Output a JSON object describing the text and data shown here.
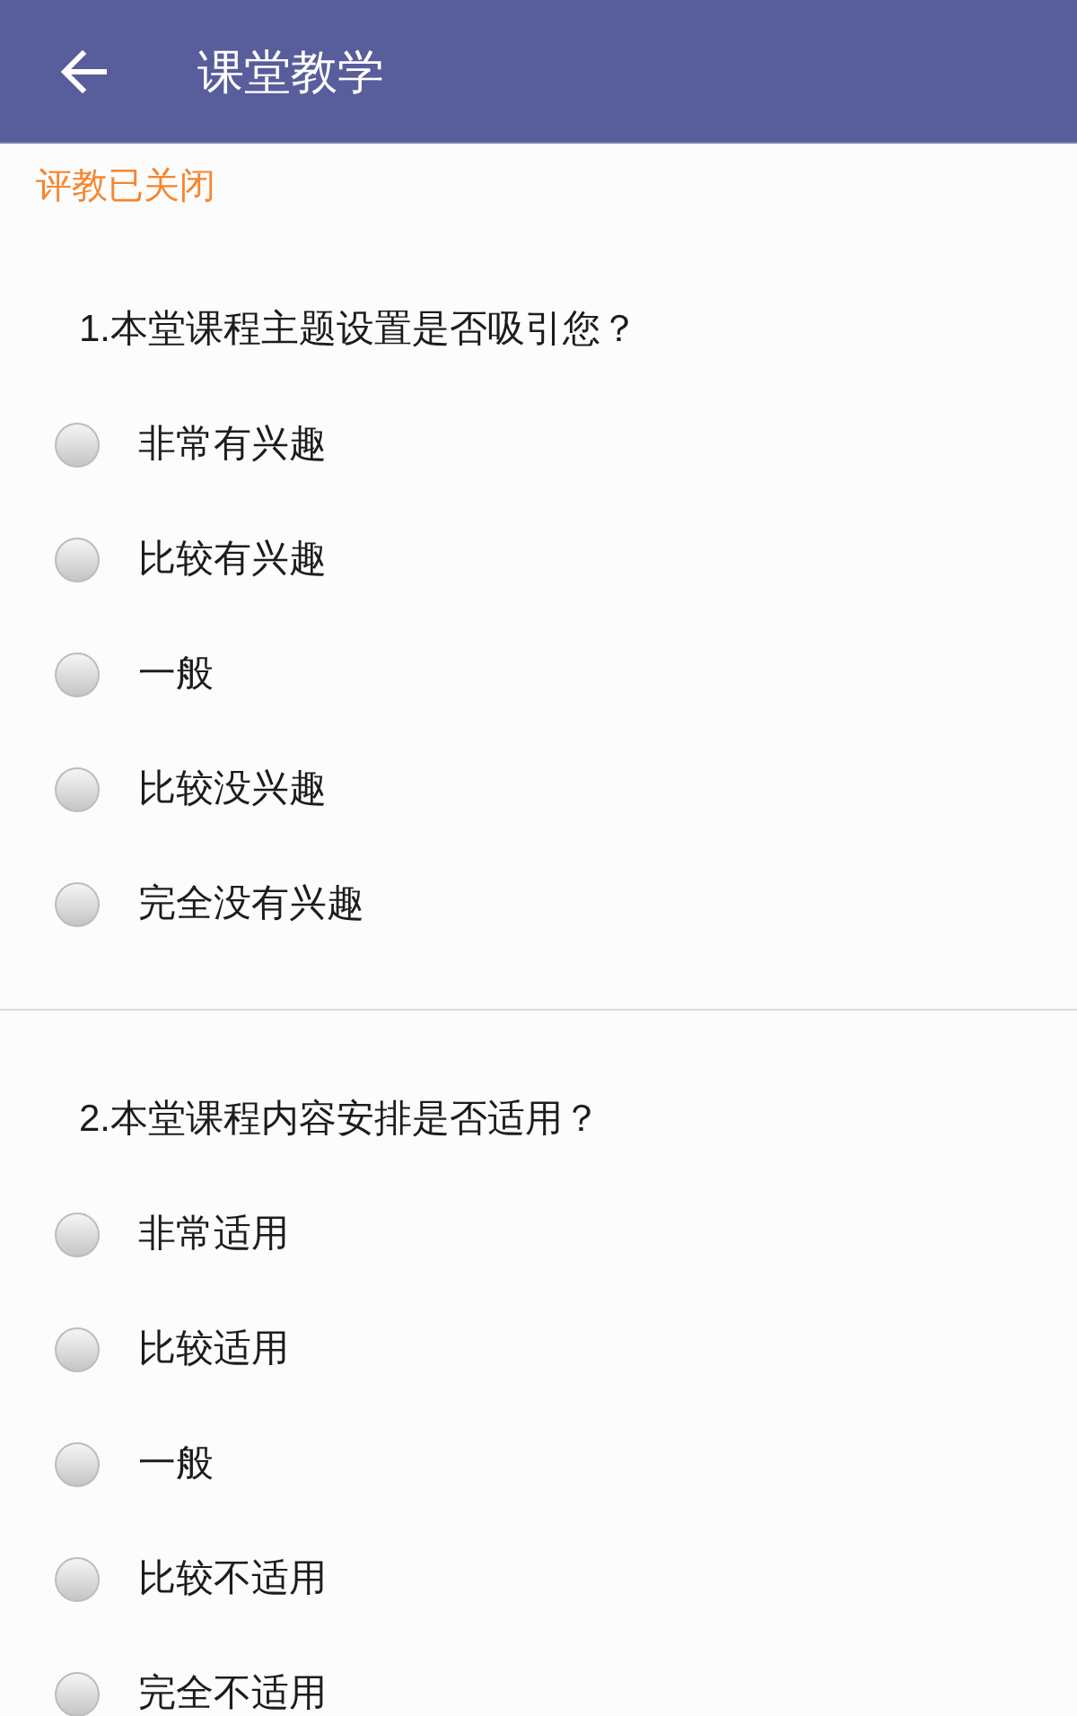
{
  "app_bar": {
    "title": "课堂教学"
  },
  "notice": "评教已关闭",
  "questions": [
    {
      "text": "1.本堂课程主题设置是否吸引您？",
      "options": [
        {
          "label": "非常有兴趣",
          "selected": false
        },
        {
          "label": "比较有兴趣",
          "selected": false
        },
        {
          "label": "一般",
          "selected": false
        },
        {
          "label": "比较没兴趣",
          "selected": false
        },
        {
          "label": "完全没有兴趣",
          "selected": false
        }
      ]
    },
    {
      "text": "2.本堂课程内容安排是否适用？",
      "options": [
        {
          "label": "非常适用",
          "selected": false
        },
        {
          "label": "比较适用",
          "selected": false
        },
        {
          "label": "一般",
          "selected": false
        },
        {
          "label": "比较不适用",
          "selected": false
        },
        {
          "label": "完全不适用",
          "selected": false
        }
      ]
    }
  ]
}
